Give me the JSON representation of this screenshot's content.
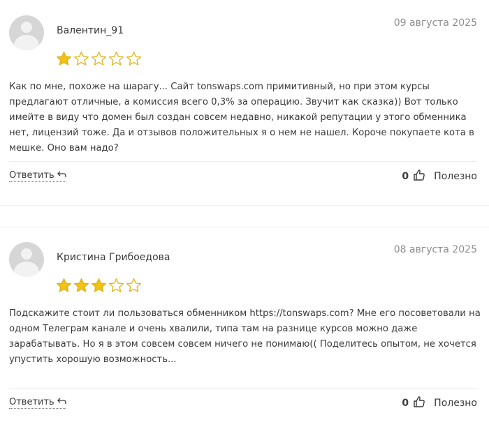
{
  "reviews": [
    {
      "author": "Валентин_91",
      "date": "09 августа 2025",
      "rating": 1,
      "max_rating": 5,
      "text": "Как по мне, похоже на шарагу... Сайт tonswaps.com примитивный, но при этом курсы предлагают отличные, а комиссия всего 0,3% за операцию. Звучит как сказка)) Вот только имейте в виду что домен был создан совсем недавно, никакой репутации у этого обменника нет, лицензий тоже. Да и отзывов положительных я о нем не нашел. Короче покупаете кота в мешке. Оно вам надо?",
      "reply_label": "Ответить",
      "helpful_count": "0",
      "helpful_label": "Полезно"
    },
    {
      "author": "Кристина Грибоедова",
      "date": "08 августа 2025",
      "rating": 3,
      "max_rating": 5,
      "text": "Подскажите стоит ли пользоваться обменником https://tonswaps.com? Мне его посоветовали на одном Телеграм канале и очень хвалили, типа там на разнице курсов можно даже зарабатывать. Но я в этом совсем совсем ничего не понимаю(( Поделитесь опытом, не хочется упустить хорошую возможность...",
      "reply_label": "Ответить",
      "helpful_count": "0",
      "helpful_label": "Полезно"
    }
  ],
  "icons": {
    "star_filled": "star-filled-icon",
    "star_empty": "star-empty-icon",
    "reply": "reply-arrow-icon",
    "thumb": "thumbs-up-icon"
  },
  "colors": {
    "star_fill": "#f2c314",
    "star_outline": "#e0b010",
    "text": "#3a3a3a",
    "date": "#8c8c8c"
  }
}
